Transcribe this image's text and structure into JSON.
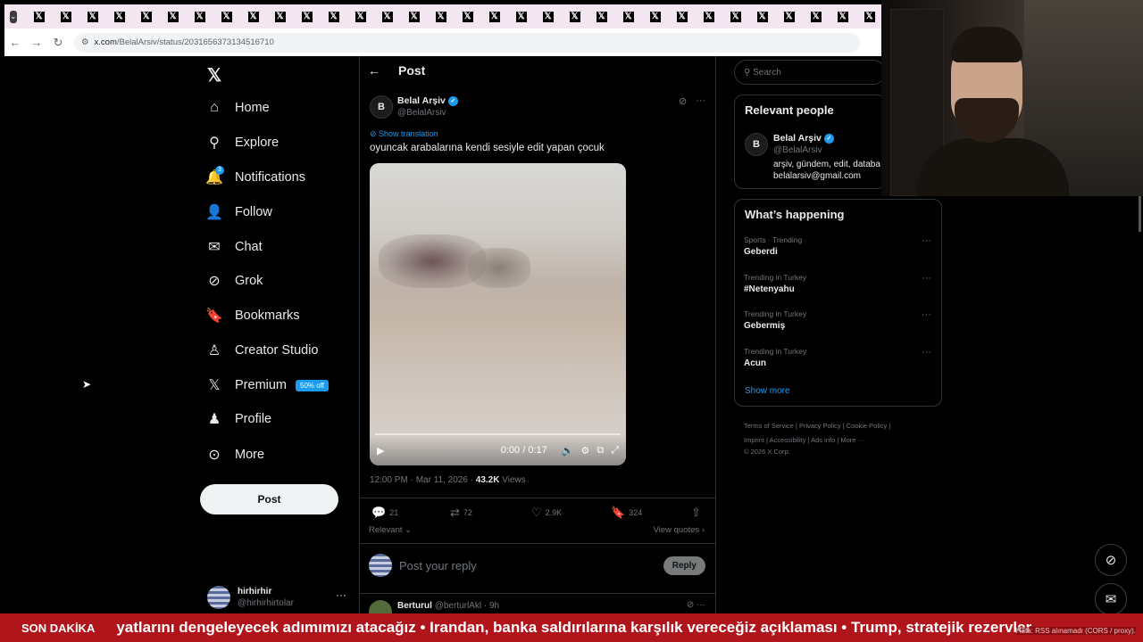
{
  "browser": {
    "tab_count": 32,
    "tab_glyph": "𝕏",
    "url_host": "x.com",
    "url_path": "/BelalArsiv/status/2031656373134516710"
  },
  "nav": {
    "items": [
      {
        "label": "Home",
        "icon": "home-icon",
        "glyph": "⌂"
      },
      {
        "label": "Explore",
        "icon": "search-icon",
        "glyph": "⚲"
      },
      {
        "label": "Notifications",
        "icon": "bell-icon",
        "glyph": "🔔"
      },
      {
        "label": "Follow",
        "icon": "add-person-icon",
        "glyph": "👤"
      },
      {
        "label": "Chat",
        "icon": "mail-icon",
        "glyph": "✉"
      },
      {
        "label": "Grok",
        "icon": "grok-icon",
        "glyph": "⊘"
      },
      {
        "label": "Bookmarks",
        "icon": "bookmark-icon",
        "glyph": "🔖"
      },
      {
        "label": "Creator Studio",
        "icon": "creator-icon",
        "glyph": "♙"
      },
      {
        "label": "Premium",
        "icon": "x-logo-icon",
        "glyph": "𝕏"
      },
      {
        "label": "Profile",
        "icon": "person-icon",
        "glyph": "♟"
      },
      {
        "label": "More",
        "icon": "more-circle-icon",
        "glyph": "⊙"
      }
    ],
    "notif_count": "3",
    "premium_badge": "50% off",
    "post_button": "Post",
    "account": {
      "name": "hirhirhir",
      "handle": "@hirhirhirtolar"
    }
  },
  "post": {
    "header": "Post",
    "author": "Belal Arşiv",
    "handle": "@BelalArsiv",
    "show_translation": "Show translation",
    "text": "oyuncak arabalarına kendi sesiyle edit yapan çocuk",
    "video_time": "0:00 / 0:17",
    "timestamp": "12:00 PM · Mar 11, 2026 · ",
    "views_count": "43.2K",
    "views_label": " Views",
    "replies": "21",
    "reposts": "72",
    "likes": "2.9K",
    "bookmarks": "324",
    "sort": "Relevant",
    "view_quotes": "View quotes",
    "reply_placeholder": "Post your reply",
    "reply_button": "Reply",
    "comment_author": "Berturul",
    "comment_handle": "@berturlAkl · 9h"
  },
  "right": {
    "search_placeholder": "Search",
    "relevant_title": "Relevant people",
    "rel_name": "Belal Arşiv",
    "rel_handle": "@BelalArsiv",
    "rel_bio1": "arşiv, gündem, edit, databa",
    "rel_bio2": "belalarsiv@gmail.com",
    "happening_title": "What’s happening",
    "trends": [
      {
        "label": "Sports · Trending",
        "name": "Geberdi"
      },
      {
        "label": "Trending in Turkey",
        "name": "#Netenyahu"
      },
      {
        "label": "Trending in Turkey",
        "name": "Gebermiş"
      },
      {
        "label": "Trending in Turkey",
        "name": "Acun"
      }
    ],
    "show_more": "Show more",
    "footer1": "Terms of Service  |  Privacy Policy  |  Cookie Policy  |",
    "footer2": "Imprint  |  Accessibility  |  Ads info  |  More ···",
    "footer3": "© 2026 X Corp."
  },
  "ticker": {
    "label": "SON DAKİKA",
    "text": "yatlarını dengeleyecek adımımızı atacağız  •  Irandan, banka saldırılarına karşılık vereceğiz açıklaması  •  Trump, stratejik rezervler",
    "error": "Hata: RSS alınamadı (CORS / proxy)."
  },
  "colors": {
    "accent": "#1d9bf0",
    "ticker_bg": "#b0151b"
  }
}
